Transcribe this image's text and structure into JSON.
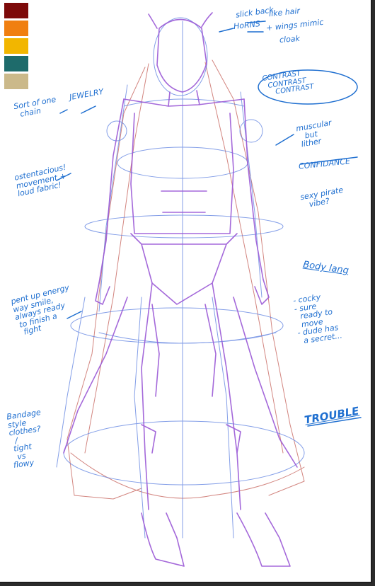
{
  "palette": [
    "#7d0a0a",
    "#f07f10",
    "#f2b600",
    "#1e6b6b",
    "#cbb98a"
  ],
  "colors": {
    "ink": "#1f6fd0",
    "sketch_purple": "#9b59d6",
    "sketch_blue": "#5a7ee0",
    "sketch_red": "#c0524a"
  },
  "notes": {
    "slick_back": "slick back",
    "horns": "HoRNS",
    "like_hair": "like hair",
    "wings_mimic": "+ wings mimic",
    "cloak": "cloak",
    "contrast": "CONTRAST\n  CONTRAST\n     CONTRAST",
    "jewelry": "JEWELRY",
    "chain": "Sort of one\n  chain",
    "muscular": "muscular\n   but\n lither",
    "confidence": "CONFIDANCE",
    "ostentatious": "ostentacious!\nmovement +\nloud fabric!",
    "sexy_pirate": "sexy pirate\n   vibe?",
    "body_lang": "Body lang",
    "body_points": "- cocky\n- sure\n  ready to\n  move\n- dude has\n  a secret...",
    "pent_up": "pent up energy\nway smile,\nalways ready\n to finish a\n  fight",
    "trouble": "TROUBLE",
    "bandage": "Bandage\nstyle\nclothes?\n  /\n tight\n  vs\nflowy"
  }
}
